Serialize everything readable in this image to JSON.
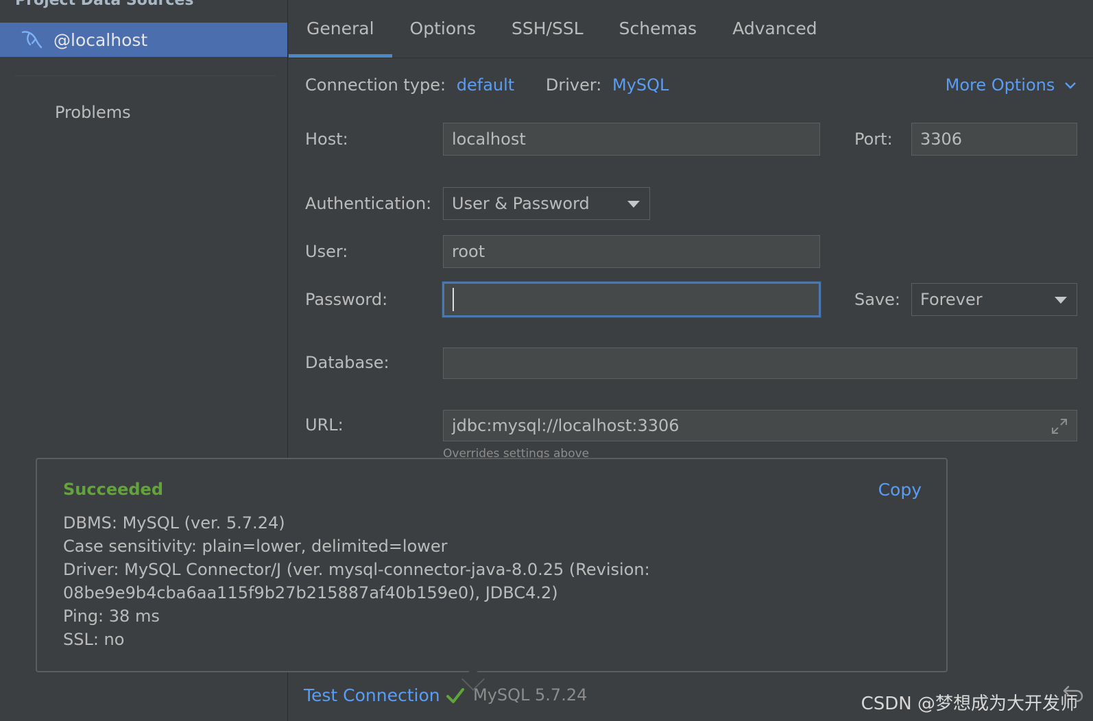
{
  "sidebar": {
    "title": "Project Data Sources",
    "selected_item": {
      "label": "@localhost",
      "icon": "mysql-dolphin-icon"
    },
    "problems_label": "Problems"
  },
  "tabs": [
    {
      "label": "General",
      "active": true
    },
    {
      "label": "Options",
      "active": false
    },
    {
      "label": "SSH/SSL",
      "active": false
    },
    {
      "label": "Schemas",
      "active": false
    },
    {
      "label": "Advanced",
      "active": false
    }
  ],
  "connection": {
    "type_label": "Connection type:",
    "type_value": "default",
    "driver_label": "Driver:",
    "driver_value": "MySQL",
    "more_options": "More Options"
  },
  "form": {
    "host_label": "Host:",
    "host_value": "localhost",
    "port_label": "Port:",
    "port_value": "3306",
    "auth_label": "Authentication:",
    "auth_value": "User & Password",
    "user_label": "User:",
    "user_value": "root",
    "password_label": "Password:",
    "password_value": "",
    "save_label": "Save:",
    "save_value": "Forever",
    "database_label": "Database:",
    "database_value": "",
    "url_label": "URL:",
    "url_value": "jdbc:mysql://localhost:3306",
    "url_hint": "Overrides settings above"
  },
  "popup": {
    "status": "Succeeded",
    "copy_label": "Copy",
    "lines": [
      "DBMS: MySQL (ver. 5.7.24)",
      "Case sensitivity: plain=lower, delimited=lower",
      "Driver: MySQL Connector/J (ver. mysql-connector-java-8.0.25 (Revision:",
      "08be9e9b4cba6aa115f9b27b215887af40b159e0), JDBC4.2)",
      "Ping: 38 ms",
      "SSL: no"
    ]
  },
  "footer": {
    "test_connection": "Test Connection",
    "version": "MySQL 5.7.24",
    "watermark": "CSDN @梦想成为大开发师"
  },
  "colors": {
    "background": "#3c3f41",
    "selection": "#4b6eaf",
    "link": "#589df6",
    "success": "#62a33c",
    "focus_border": "#4a78b0"
  }
}
